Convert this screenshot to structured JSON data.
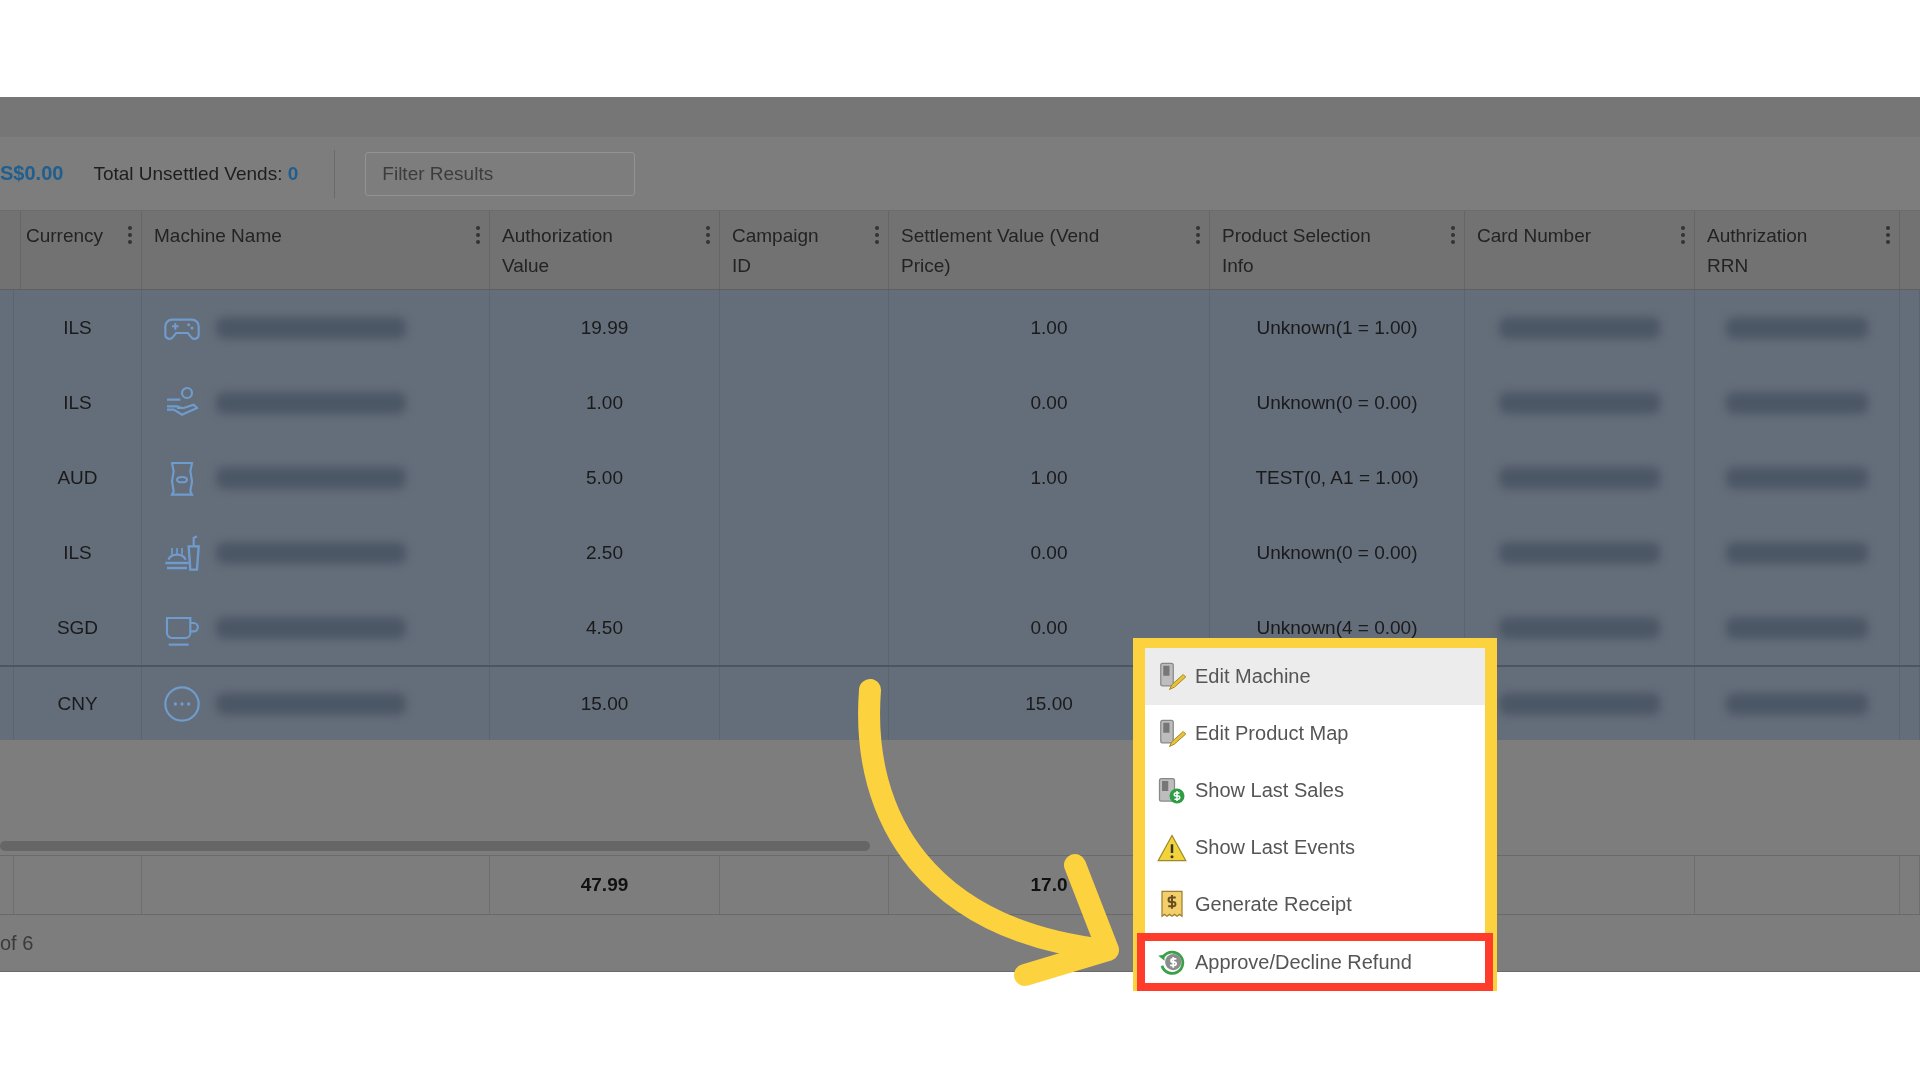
{
  "toolbar": {
    "total": "S$0.00",
    "unsettled_label": "Total Unsettled Vends:",
    "unsettled_value": "0",
    "filter": {
      "placeholder": "Filter Results"
    }
  },
  "table": {
    "columns": [
      "Currency",
      "Machine Name",
      "Authorization Value",
      "Campaign ID",
      "Settlement Value (Vend Price)",
      "Product Selection Info",
      "Card Number",
      "Authrization RRN"
    ],
    "rows": [
      {
        "selected": true,
        "currency": "ILS",
        "machine": {
          "kind": "game",
          "redacted": true
        },
        "authorization": "19.99",
        "settlement": "1.00",
        "product": "Unknown(1 = 1.00)",
        "card_redacted": true,
        "rrn_redacted": true
      },
      {
        "selected": true,
        "currency": "ILS",
        "machine": {
          "kind": "service",
          "redacted": true
        },
        "authorization": "1.00",
        "settlement": "0.00",
        "product": "Unknown(0 = 0.00)",
        "card_redacted": true,
        "rrn_redacted": true
      },
      {
        "selected": true,
        "currency": "AUD",
        "machine": {
          "kind": "snack",
          "redacted": true
        },
        "authorization": "5.00",
        "settlement": "1.00",
        "product": "TEST(0, A1 = 1.00)",
        "card_redacted": true,
        "rrn_redacted": true
      },
      {
        "selected": true,
        "currency": "ILS",
        "machine": {
          "kind": "food",
          "redacted": true
        },
        "authorization": "2.50",
        "settlement": "0.00",
        "product": "Unknown(0 = 0.00)",
        "card_redacted": true,
        "rrn_redacted": true
      },
      {
        "selected": true,
        "currency": "SGD",
        "machine": {
          "kind": "cup",
          "redacted": true
        },
        "authorization": "4.50",
        "settlement": "0.00",
        "product": "Unknown(4 = 0.00)",
        "card_redacted": true,
        "rrn_redacted": true
      },
      {
        "selected": true,
        "currency": "CNY",
        "machine": {
          "kind": "other",
          "redacted": true
        },
        "authorization": "15.00",
        "settlement": "15.00",
        "card_redacted": true,
        "rrn_redacted": true
      }
    ],
    "totals": {
      "authorization": "47.99",
      "settlement": "17.0"
    }
  },
  "pager": "of 6",
  "context_menu": [
    {
      "label": "Edit Machine",
      "kind": "edit",
      "highlighted": true,
      "callout": false
    },
    {
      "label": "Edit Product Map",
      "kind": "edit",
      "highlighted": false,
      "callout": false
    },
    {
      "label": "Show Last Sales",
      "kind": "sales",
      "highlighted": false,
      "callout": false
    },
    {
      "label": "Show Last Events",
      "kind": "warning",
      "highlighted": false,
      "callout": false
    },
    {
      "label": "Generate Receipt",
      "kind": "receipt",
      "highlighted": false,
      "callout": false
    },
    {
      "label": "Approve/Decline Refund",
      "kind": "refund",
      "highlighted": false,
      "callout": true
    }
  ]
}
